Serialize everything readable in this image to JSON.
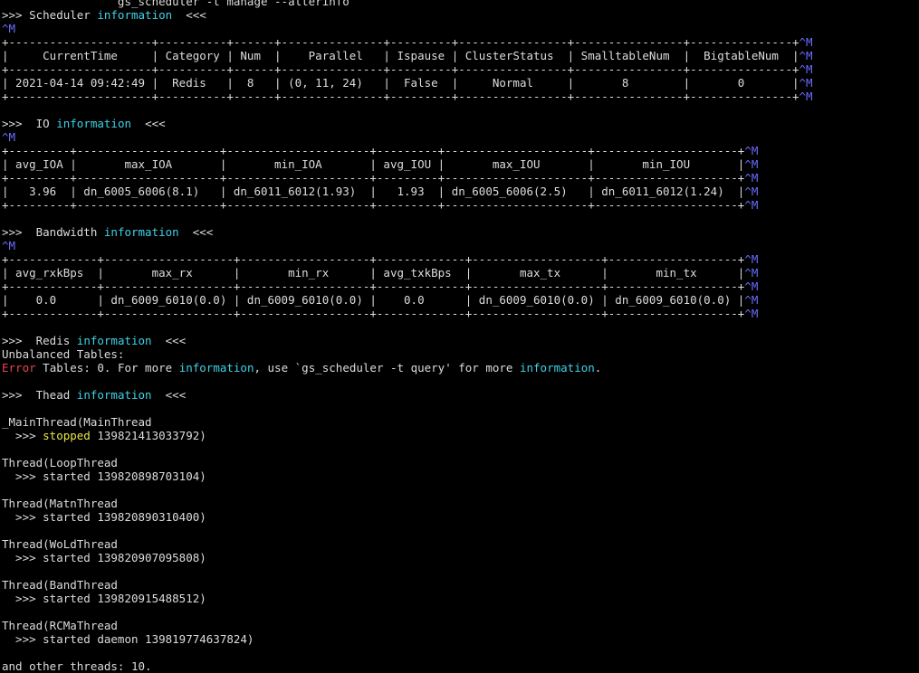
{
  "colors": {
    "background": "#000000",
    "default": "#dcdcdc",
    "cyan": "#3fd2e6",
    "blue": "#6b6bff",
    "red": "#e8474c",
    "yellow": "#e6e64a"
  },
  "lines": [
    {
      "name": "command-line",
      "segs": [
        {
          "t": "                 gs_scheduler -t manage --alterinfo",
          "c": "default"
        }
      ]
    },
    {
      "name": "scheduler-heading",
      "segs": [
        {
          "t": ">>> Scheduler ",
          "c": "default"
        },
        {
          "t": "information",
          "c": "cyan"
        },
        {
          "t": "  <<<",
          "c": "default"
        }
      ]
    },
    {
      "name": "carriage-return-marker",
      "segs": [
        {
          "t": "^M",
          "c": "blue"
        }
      ]
    },
    {
      "name": "scheduler-table-border",
      "segs": [
        {
          "t": "+---------------------+----------+------+---------------+---------+----------------+----------------+---------------+",
          "c": "default"
        },
        {
          "t": "^M",
          "c": "blue"
        }
      ]
    },
    {
      "name": "scheduler-table-header",
      "segs": [
        {
          "t": "|     CurrentTime     | Category | Num  |    Parallel   | Ispause | ClusterStatus  | SmalltableNum  |  BigtableNum  |",
          "c": "default"
        },
        {
          "t": "^M",
          "c": "blue"
        }
      ]
    },
    {
      "name": "scheduler-table-border",
      "segs": [
        {
          "t": "+---------------------+----------+------+---------------+---------+----------------+----------------+---------------+",
          "c": "default"
        },
        {
          "t": "^M",
          "c": "blue"
        }
      ]
    },
    {
      "name": "scheduler-table-row",
      "segs": [
        {
          "t": "| 2021-04-14 09:42:49 |  Redis   |  8   | (0, 11, 24)   |  False  |     Normal     |       8        |       0       |",
          "c": "default"
        },
        {
          "t": "^M",
          "c": "blue"
        }
      ]
    },
    {
      "name": "scheduler-table-border",
      "segs": [
        {
          "t": "+---------------------+----------+------+---------------+---------+----------------+----------------+---------------+",
          "c": "default"
        },
        {
          "t": "^M",
          "c": "blue"
        }
      ]
    },
    {
      "name": "blank-line",
      "segs": []
    },
    {
      "name": "io-heading",
      "segs": [
        {
          "t": ">>>  IO ",
          "c": "default"
        },
        {
          "t": "information",
          "c": "cyan"
        },
        {
          "t": "  <<<",
          "c": "default"
        }
      ]
    },
    {
      "name": "carriage-return-marker",
      "segs": [
        {
          "t": "^M",
          "c": "blue"
        }
      ]
    },
    {
      "name": "io-table-border",
      "segs": [
        {
          "t": "+---------+---------------------+---------------------+---------+---------------------+---------------------+",
          "c": "default"
        },
        {
          "t": "^M",
          "c": "blue"
        }
      ]
    },
    {
      "name": "io-table-header",
      "segs": [
        {
          "t": "| avg_IOA |       max_IOA       |       min_IOA       | avg_IOU |       max_IOU       |       min_IOU       |",
          "c": "default"
        },
        {
          "t": "^M",
          "c": "blue"
        }
      ]
    },
    {
      "name": "io-table-border",
      "segs": [
        {
          "t": "+---------+---------------------+---------------------+---------+---------------------+---------------------+",
          "c": "default"
        },
        {
          "t": "^M",
          "c": "blue"
        }
      ]
    },
    {
      "name": "io-table-row",
      "segs": [
        {
          "t": "|   3.96  | dn_6005_6006(8.1)   | dn_6011_6012(1.93)  |   1.93  | dn_6005_6006(2.5)   | dn_6011_6012(1.24)  |",
          "c": "default"
        },
        {
          "t": "^M",
          "c": "blue"
        }
      ]
    },
    {
      "name": "io-table-border",
      "segs": [
        {
          "t": "+---------+---------------------+---------------------+---------+---------------------+---------------------+",
          "c": "default"
        },
        {
          "t": "^M",
          "c": "blue"
        }
      ]
    },
    {
      "name": "blank-line",
      "segs": []
    },
    {
      "name": "bandwidth-heading",
      "segs": [
        {
          "t": ">>>  Bandwidth ",
          "c": "default"
        },
        {
          "t": "information",
          "c": "cyan"
        },
        {
          "t": "  <<<",
          "c": "default"
        }
      ]
    },
    {
      "name": "carriage-return-marker",
      "segs": [
        {
          "t": "^M",
          "c": "blue"
        }
      ]
    },
    {
      "name": "bandwidth-table-border",
      "segs": [
        {
          "t": "+-------------+-------------------+-------------------+-------------+-------------------+-------------------+",
          "c": "default"
        },
        {
          "t": "^M",
          "c": "blue"
        }
      ]
    },
    {
      "name": "bandwidth-table-header",
      "segs": [
        {
          "t": "| avg_rxkBps  |       max_rx      |       min_rx      | avg_txkBps  |       max_tx      |       min_tx      |",
          "c": "default"
        },
        {
          "t": "^M",
          "c": "blue"
        }
      ]
    },
    {
      "name": "bandwidth-table-border",
      "segs": [
        {
          "t": "+-------------+-------------------+-------------------+-------------+-------------------+-------------------+",
          "c": "default"
        },
        {
          "t": "^M",
          "c": "blue"
        }
      ]
    },
    {
      "name": "bandwidth-table-row",
      "segs": [
        {
          "t": "|    0.0      | dn_6009_6010(0.0) | dn_6009_6010(0.0) |    0.0      | dn_6009_6010(0.0) | dn_6009_6010(0.0) |",
          "c": "default"
        },
        {
          "t": "^M",
          "c": "blue"
        }
      ]
    },
    {
      "name": "bandwidth-table-border",
      "segs": [
        {
          "t": "+-------------+-------------------+-------------------+-------------+-------------------+-------------------+",
          "c": "default"
        },
        {
          "t": "^M",
          "c": "blue"
        }
      ]
    },
    {
      "name": "blank-line",
      "segs": []
    },
    {
      "name": "redis-heading",
      "segs": [
        {
          "t": ">>>  Redis ",
          "c": "default"
        },
        {
          "t": "information",
          "c": "cyan"
        },
        {
          "t": "  <<<",
          "c": "default"
        }
      ]
    },
    {
      "name": "unbalanced-tables-line",
      "segs": [
        {
          "t": "Unbalanced Tables:",
          "c": "default"
        }
      ]
    },
    {
      "name": "error-tables-line",
      "segs": [
        {
          "t": "Error",
          "c": "red"
        },
        {
          "t": " Tables: 0. For more ",
          "c": "default"
        },
        {
          "t": "information",
          "c": "cyan"
        },
        {
          "t": ", use `gs_scheduler -t query' for more ",
          "c": "default"
        },
        {
          "t": "information",
          "c": "cyan"
        },
        {
          "t": ".",
          "c": "default"
        }
      ]
    },
    {
      "name": "blank-line",
      "segs": []
    },
    {
      "name": "thead-heading",
      "segs": [
        {
          "t": ">>>  Thead ",
          "c": "default"
        },
        {
          "t": "information",
          "c": "cyan"
        },
        {
          "t": "  <<<",
          "c": "default"
        }
      ]
    },
    {
      "name": "blank-line",
      "segs": []
    },
    {
      "name": "thread-name-line",
      "segs": [
        {
          "t": "_MainThread(MainThread",
          "c": "default"
        }
      ]
    },
    {
      "name": "thread-status-line",
      "segs": [
        {
          "t": "  >>> ",
          "c": "default"
        },
        {
          "t": "stopped",
          "c": "yellow"
        },
        {
          "t": " 139821413033792)",
          "c": "default"
        }
      ]
    },
    {
      "name": "blank-line",
      "segs": []
    },
    {
      "name": "thread-name-line",
      "segs": [
        {
          "t": "Thread(LoopThread",
          "c": "default"
        }
      ]
    },
    {
      "name": "thread-status-line",
      "segs": [
        {
          "t": "  >>> started 139820898703104)",
          "c": "default"
        }
      ]
    },
    {
      "name": "blank-line",
      "segs": []
    },
    {
      "name": "thread-name-line",
      "segs": [
        {
          "t": "Thread(MatnThread",
          "c": "default"
        }
      ]
    },
    {
      "name": "thread-status-line",
      "segs": [
        {
          "t": "  >>> started 139820890310400)",
          "c": "default"
        }
      ]
    },
    {
      "name": "blank-line",
      "segs": []
    },
    {
      "name": "thread-name-line",
      "segs": [
        {
          "t": "Thread(WoLdThread",
          "c": "default"
        }
      ]
    },
    {
      "name": "thread-status-line",
      "segs": [
        {
          "t": "  >>> started 139820907095808)",
          "c": "default"
        }
      ]
    },
    {
      "name": "blank-line",
      "segs": []
    },
    {
      "name": "thread-name-line",
      "segs": [
        {
          "t": "Thread(BandThread",
          "c": "default"
        }
      ]
    },
    {
      "name": "thread-status-line",
      "segs": [
        {
          "t": "  >>> started 139820915488512)",
          "c": "default"
        }
      ]
    },
    {
      "name": "blank-line",
      "segs": []
    },
    {
      "name": "thread-name-line",
      "segs": [
        {
          "t": "Thread(RCMaThread",
          "c": "default"
        }
      ]
    },
    {
      "name": "thread-status-line",
      "segs": [
        {
          "t": "  >>> started daemon 139819774637824)",
          "c": "default"
        }
      ]
    },
    {
      "name": "blank-line",
      "segs": []
    },
    {
      "name": "other-threads-line",
      "segs": [
        {
          "t": "and other threads: 10.",
          "c": "default"
        }
      ]
    }
  ]
}
